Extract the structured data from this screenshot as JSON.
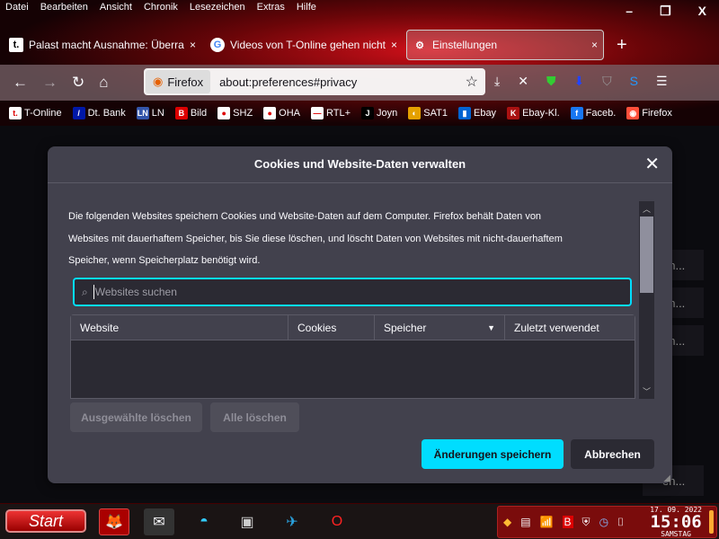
{
  "menu": [
    "Datei",
    "Bearbeiten",
    "Ansicht",
    "Chronik",
    "Lesezeichen",
    "Extras",
    "Hilfe"
  ],
  "window": {
    "min": "–",
    "restore": "❐",
    "close": "X"
  },
  "tabs": [
    {
      "icon": "t.",
      "title": "Palast macht Ausnahme: Überraschung",
      "close": "×"
    },
    {
      "icon": "G",
      "title": "Videos von T-Online gehen nicht auf",
      "close": "×"
    },
    {
      "icon": "⚙",
      "title": "Einstellungen",
      "close": "×"
    }
  ],
  "newtab": "+",
  "nav": {
    "identity": "Firefox",
    "url": "about:preferences#privacy"
  },
  "bookmarks": [
    {
      "label": "T-Online",
      "icon": "t.",
      "color": "#ffffff"
    },
    {
      "label": "Dt. Bank",
      "icon": "/",
      "color": "#0018a8"
    },
    {
      "label": "LN",
      "icon": "LN",
      "color": "#3355aa"
    },
    {
      "label": "Bild",
      "icon": "B",
      "color": "#dd0000"
    },
    {
      "label": "SHZ",
      "icon": "●",
      "color": "#ffffff"
    },
    {
      "label": "OHA",
      "icon": "●",
      "color": "#ffffff"
    },
    {
      "label": "RTL+",
      "icon": "—",
      "color": "#ffffff"
    },
    {
      "label": "Joyn",
      "icon": "J",
      "color": "#000000"
    },
    {
      "label": "SAT1",
      "icon": "◐",
      "color": "#e5a000"
    },
    {
      "label": "Ebay",
      "icon": "▮",
      "color": "#0064d2"
    },
    {
      "label": "Ebay-Kl.",
      "icon": "K",
      "color": "#aa1111"
    },
    {
      "label": "Faceb.",
      "icon": "f",
      "color": "#1877f2"
    },
    {
      "label": "Firefox",
      "icon": "◉",
      "color": "#ff4f3a"
    }
  ],
  "background_buttons": [
    "en...",
    "en...",
    "en...",
    "en..."
  ],
  "dialog": {
    "title": "Cookies und Website-Daten verwalten",
    "close": "✕",
    "description": [
      "Die folgenden Websites speichern Cookies und Website-Daten auf dem Computer. Firefox behält Daten von",
      "Websites mit dauerhaftem Speicher, bis Sie diese löschen, und löscht Daten von Websites mit nicht-dauerhaftem",
      "Speicher, wenn Speicherplatz benötigt wird."
    ],
    "search_placeholder": "Websites suchen",
    "columns": [
      "Website",
      "Cookies",
      "Speicher",
      "Zuletzt verwendet"
    ],
    "sort_indicator": "▼",
    "remove_selected": "Ausgewählte löschen",
    "remove_all": "Alle löschen",
    "save": "Änderungen speichern",
    "cancel": "Abbrechen"
  },
  "taskbar": {
    "start": "Start"
  },
  "clock": {
    "date": "17. 09. 2022",
    "time": "15:06",
    "weekday": "SAMSTAG"
  },
  "colors": {
    "accent": "#00ddff",
    "dialog": "#42414d"
  }
}
